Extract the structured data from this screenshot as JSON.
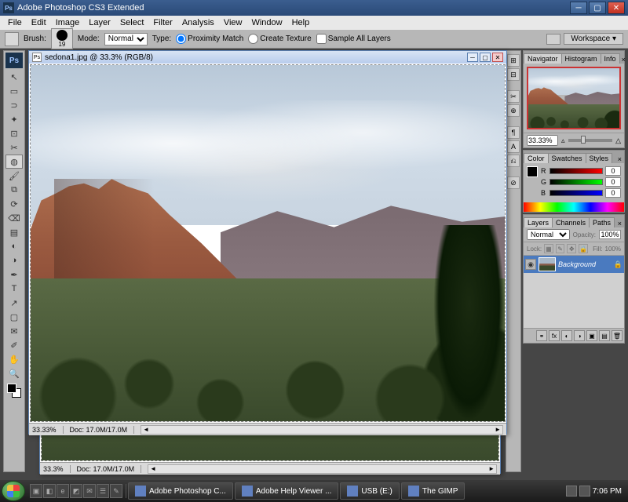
{
  "titlebar": {
    "app_icon": "Ps",
    "title": "Adobe Photoshop CS3 Extended"
  },
  "menu": {
    "items": [
      "File",
      "Edit",
      "Image",
      "Layer",
      "Select",
      "Filter",
      "Analysis",
      "View",
      "Window",
      "Help"
    ]
  },
  "options": {
    "brush_label": "Brush:",
    "brush_size": "19",
    "mode_label": "Mode:",
    "mode_value": "Normal",
    "type_label": "Type:",
    "type_radios": [
      {
        "label": "Proximity Match",
        "checked": true
      },
      {
        "label": "Create Texture",
        "checked": false
      }
    ],
    "sample_all_label": "Sample All Layers",
    "sample_all_checked": false,
    "workspace_label": "Workspace"
  },
  "tools": [
    "move",
    "marquee",
    "lasso",
    "wand",
    "crop",
    "slice",
    "healing",
    "brush",
    "stamp",
    "history",
    "eraser",
    "gradient",
    "blur",
    "dodge",
    "pen",
    "type",
    "path",
    "shape",
    "notes",
    "eyedrop",
    "hand",
    "zoom"
  ],
  "tool_icons": [
    "↖",
    "▭",
    "⊃",
    "✦",
    "⊡",
    "✂",
    "◍",
    "🖌",
    "⧉",
    "⟳",
    "⌫",
    "▤",
    "◐",
    "◑",
    "✒",
    "T",
    "↗",
    "▢",
    "✉",
    "✐",
    "✋",
    "🔍"
  ],
  "doc": {
    "title": "sedona1.jpg @ 33.3% (RGB/8)",
    "status_zoom": "33.33%",
    "status_doc": "Doc: 17.0M/17.0M"
  },
  "doc2": {
    "status_zoom": "33.3%",
    "status_doc": "Doc: 17.0M/17.0M"
  },
  "dock_icons": [
    "⊞",
    "⊟",
    "✂",
    "⊕",
    "¶",
    "A",
    "⎌",
    "⊘"
  ],
  "navigator": {
    "tabs": [
      "Navigator",
      "Histogram",
      "Info"
    ],
    "zoom": "33.33%"
  },
  "color": {
    "tabs": [
      "Color",
      "Swatches",
      "Styles"
    ],
    "r_label": "R",
    "r_val": "0",
    "g_label": "G",
    "g_val": "0",
    "b_label": "B",
    "b_val": "0"
  },
  "layers": {
    "tabs": [
      "Layers",
      "Channels",
      "Paths"
    ],
    "blend_mode": "Normal",
    "opacity_label": "Opacity:",
    "opacity": "100%",
    "lock_label": "Lock:",
    "fill_label": "Fill:",
    "fill": "100%",
    "items": [
      {
        "name": "Background",
        "locked": true
      }
    ]
  },
  "taskbar": {
    "items": [
      "Adobe Photoshop C...",
      "Adobe Help Viewer ...",
      "USB (E:)",
      "The GIMP"
    ],
    "time": "7:06 PM"
  }
}
